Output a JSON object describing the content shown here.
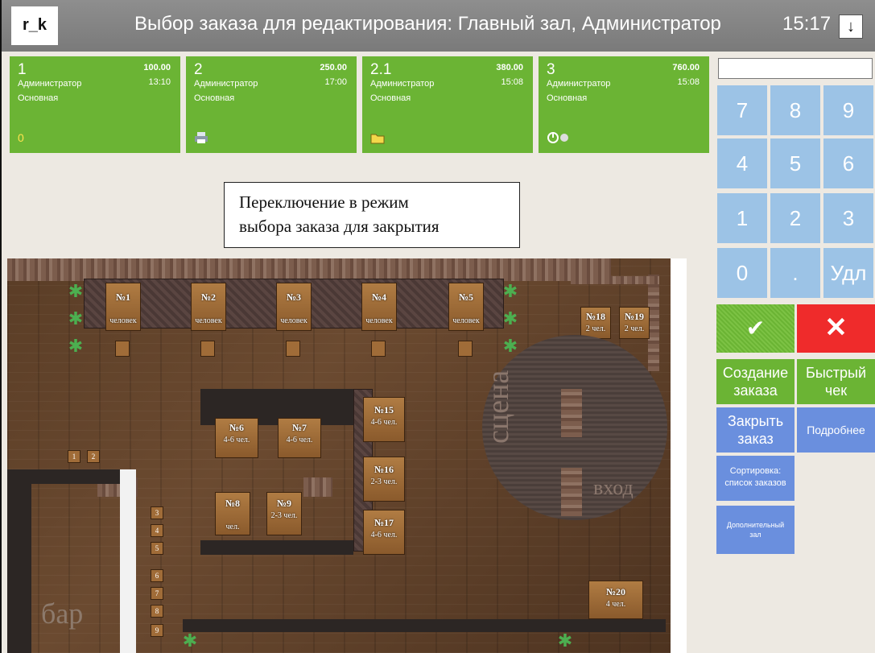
{
  "header": {
    "logo": "r_k",
    "title": "Выбор заказа для редактирования: Главный зал, Администратор",
    "time": "15:17",
    "arrow": "↓"
  },
  "orders": [
    {
      "number": "1",
      "amount": "100.00",
      "user": "Администратор",
      "time": "13:10",
      "type": "Основная",
      "status_icon": "0"
    },
    {
      "number": "2",
      "amount": "250.00",
      "user": "Администратор",
      "time": "17:00",
      "type": "Основная",
      "status_icon": "printer-icon"
    },
    {
      "number": "2.1",
      "amount": "380.00",
      "user": "Администратор",
      "time": "15:08",
      "type": "Основная",
      "status_icon": "folder-icon"
    },
    {
      "number": "3",
      "amount": "760.00",
      "user": "Администратор",
      "time": "15:08",
      "type": "Основная",
      "status_icon": "power-icon"
    }
  ],
  "tooltip": {
    "line1": "Переключение в режим",
    "line2": "выбора заказа для закрытия"
  },
  "floor": {
    "tables": [
      {
        "label": "№1",
        "sub": "человек"
      },
      {
        "label": "№2",
        "sub": "человек"
      },
      {
        "label": "№3",
        "sub": "человек"
      },
      {
        "label": "№4",
        "sub": "человек"
      },
      {
        "label": "№5",
        "sub": "человек"
      },
      {
        "label": "№18",
        "sub": "2 чел."
      },
      {
        "label": "№19",
        "sub": "2 чел."
      },
      {
        "label": "№6",
        "sub": "4-6 чел."
      },
      {
        "label": "№7",
        "sub": "4-6 чел."
      },
      {
        "label": "№15",
        "sub": "4-6 чел."
      },
      {
        "label": "№16",
        "sub": "2-3 чел."
      },
      {
        "label": "№17",
        "sub": "4-6 чел."
      },
      {
        "label": "№8",
        "sub": "чел."
      },
      {
        "label": "№9",
        "sub": "2-3 чел."
      },
      {
        "label": "№20",
        "sub": "4 чел."
      }
    ],
    "stage": "сцена",
    "entrance": "вход",
    "bar": "бар",
    "stools": [
      "1",
      "2",
      "3",
      "4",
      "5",
      "6",
      "7",
      "8",
      "9"
    ]
  },
  "keypad": {
    "keys": [
      "7",
      "8",
      "9",
      "4",
      "5",
      "6",
      "1",
      "2",
      "3",
      "0",
      ".",
      "Удл"
    ]
  },
  "actions": {
    "confirm": "✔",
    "cancel": "✕",
    "create_order_1": "Создание",
    "create_order_2": "заказа",
    "quick_check_1": "Быстрый",
    "quick_check_2": "чек",
    "close_order_1": "Закрыть",
    "close_order_2": "заказ",
    "details": "Подробнее",
    "sort_1": "Сортировка:",
    "sort_2": "список заказов",
    "extra_hall_1": "Дополнительный",
    "extra_hall_2": "зал"
  },
  "colors": {
    "card_green": "#6bb434",
    "key_blue": "#9cc3e6",
    "action_blue": "#6a8fde",
    "cancel_red": "#ef2b2b",
    "header_gray": "#858585"
  }
}
